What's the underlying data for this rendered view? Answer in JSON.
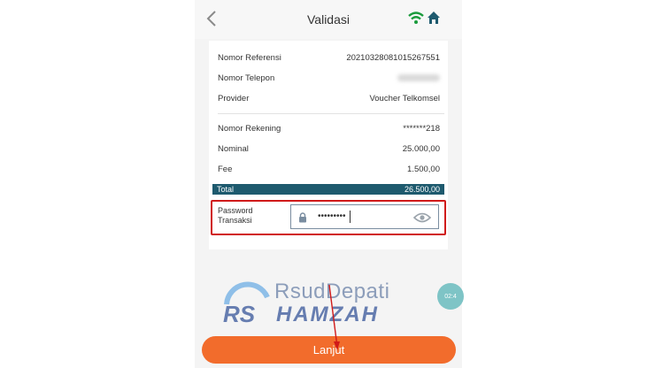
{
  "header": {
    "title": "Validasi",
    "back_icon": "chevron-left-icon",
    "status_icons": [
      "wifi-icon",
      "home-icon"
    ]
  },
  "details": {
    "reference": {
      "label": "Nomor Referensi",
      "value": "20210328081015267551"
    },
    "phone": {
      "label": "Nomor Telepon",
      "value": ""
    },
    "provider": {
      "label": "Provider",
      "value": "Voucher Telkomsel"
    },
    "account": {
      "label": "Nomor Rekening",
      "value": "*******218"
    },
    "nominal": {
      "label": "Nominal",
      "value": "25.000,00"
    },
    "fee": {
      "label": "Fee",
      "value": "1.500,00"
    },
    "total": {
      "label": "Total",
      "value": "26.500,00"
    }
  },
  "password": {
    "label_line1": "Password",
    "label_line2": "Transaksi",
    "masked_value": "•••••••••",
    "lock_icon": "lock-icon",
    "eye_icon": "eye-icon"
  },
  "side_bubble": {
    "text": "02:4"
  },
  "watermark": {
    "line1": "RsudDepati",
    "line2": "HAMZAH"
  },
  "footer": {
    "button_label": "Lanjut"
  },
  "colors": {
    "accent_orange": "#f26c2c",
    "total_bar": "#1e5a6e",
    "highlight_red": "#d01a1a",
    "wifi_green": "#1a9b3c",
    "home_navy": "#1e5a6e"
  }
}
